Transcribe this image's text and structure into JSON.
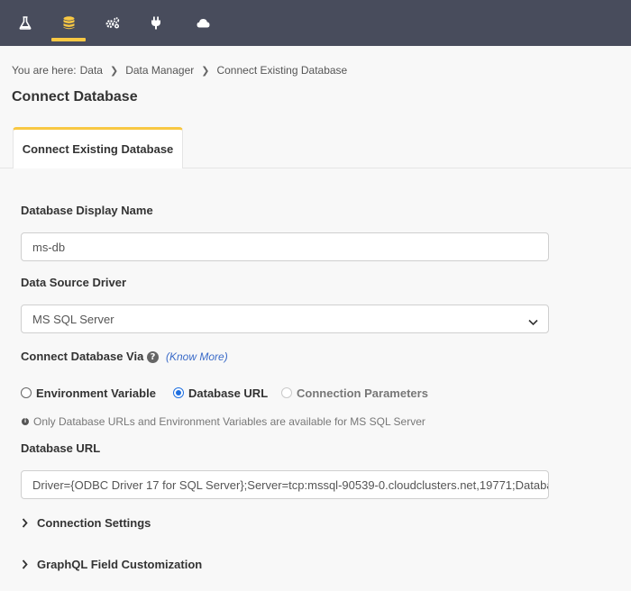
{
  "nav": {
    "items": [
      {
        "icon": "flask-icon",
        "active": false
      },
      {
        "icon": "database-icon",
        "active": true
      },
      {
        "icon": "actions-gears-icon",
        "active": false
      },
      {
        "icon": "plug-icon",
        "active": false
      },
      {
        "icon": "cloud-icon",
        "active": false
      }
    ],
    "accent": "#f8c843",
    "background": "#484c5c"
  },
  "breadcrumb": {
    "prefix": "You are here:",
    "items": [
      "Data",
      "Data Manager",
      "Connect Existing Database"
    ]
  },
  "page_title": "Connect Database",
  "tabs": [
    {
      "label": "Connect Existing Database",
      "active": true
    }
  ],
  "form": {
    "display_name": {
      "label": "Database Display Name",
      "value": "ms-db"
    },
    "driver": {
      "label": "Data Source Driver",
      "value": "MS SQL Server"
    },
    "connect_via": {
      "label": "Connect Database Via",
      "know_more": "(Know More)",
      "options": [
        {
          "label": "Environment Variable",
          "checked": false,
          "disabled": false
        },
        {
          "label": "Database URL",
          "checked": true,
          "disabled": false
        },
        {
          "label": "Connection Parameters",
          "checked": false,
          "disabled": true
        }
      ],
      "info": "Only Database URLs and Environment Variables are available for MS SQL Server"
    },
    "database_url": {
      "label": "Database URL",
      "value": "Driver={ODBC Driver 17 for SQL Server};Server=tcp:mssql-90539-0.cloudclusters.net,19771;Database=master;Uid=admin"
    },
    "sections": [
      {
        "label": "Connection Settings",
        "expanded": false
      },
      {
        "label": "GraphQL Field Customization",
        "expanded": false
      }
    ]
  }
}
